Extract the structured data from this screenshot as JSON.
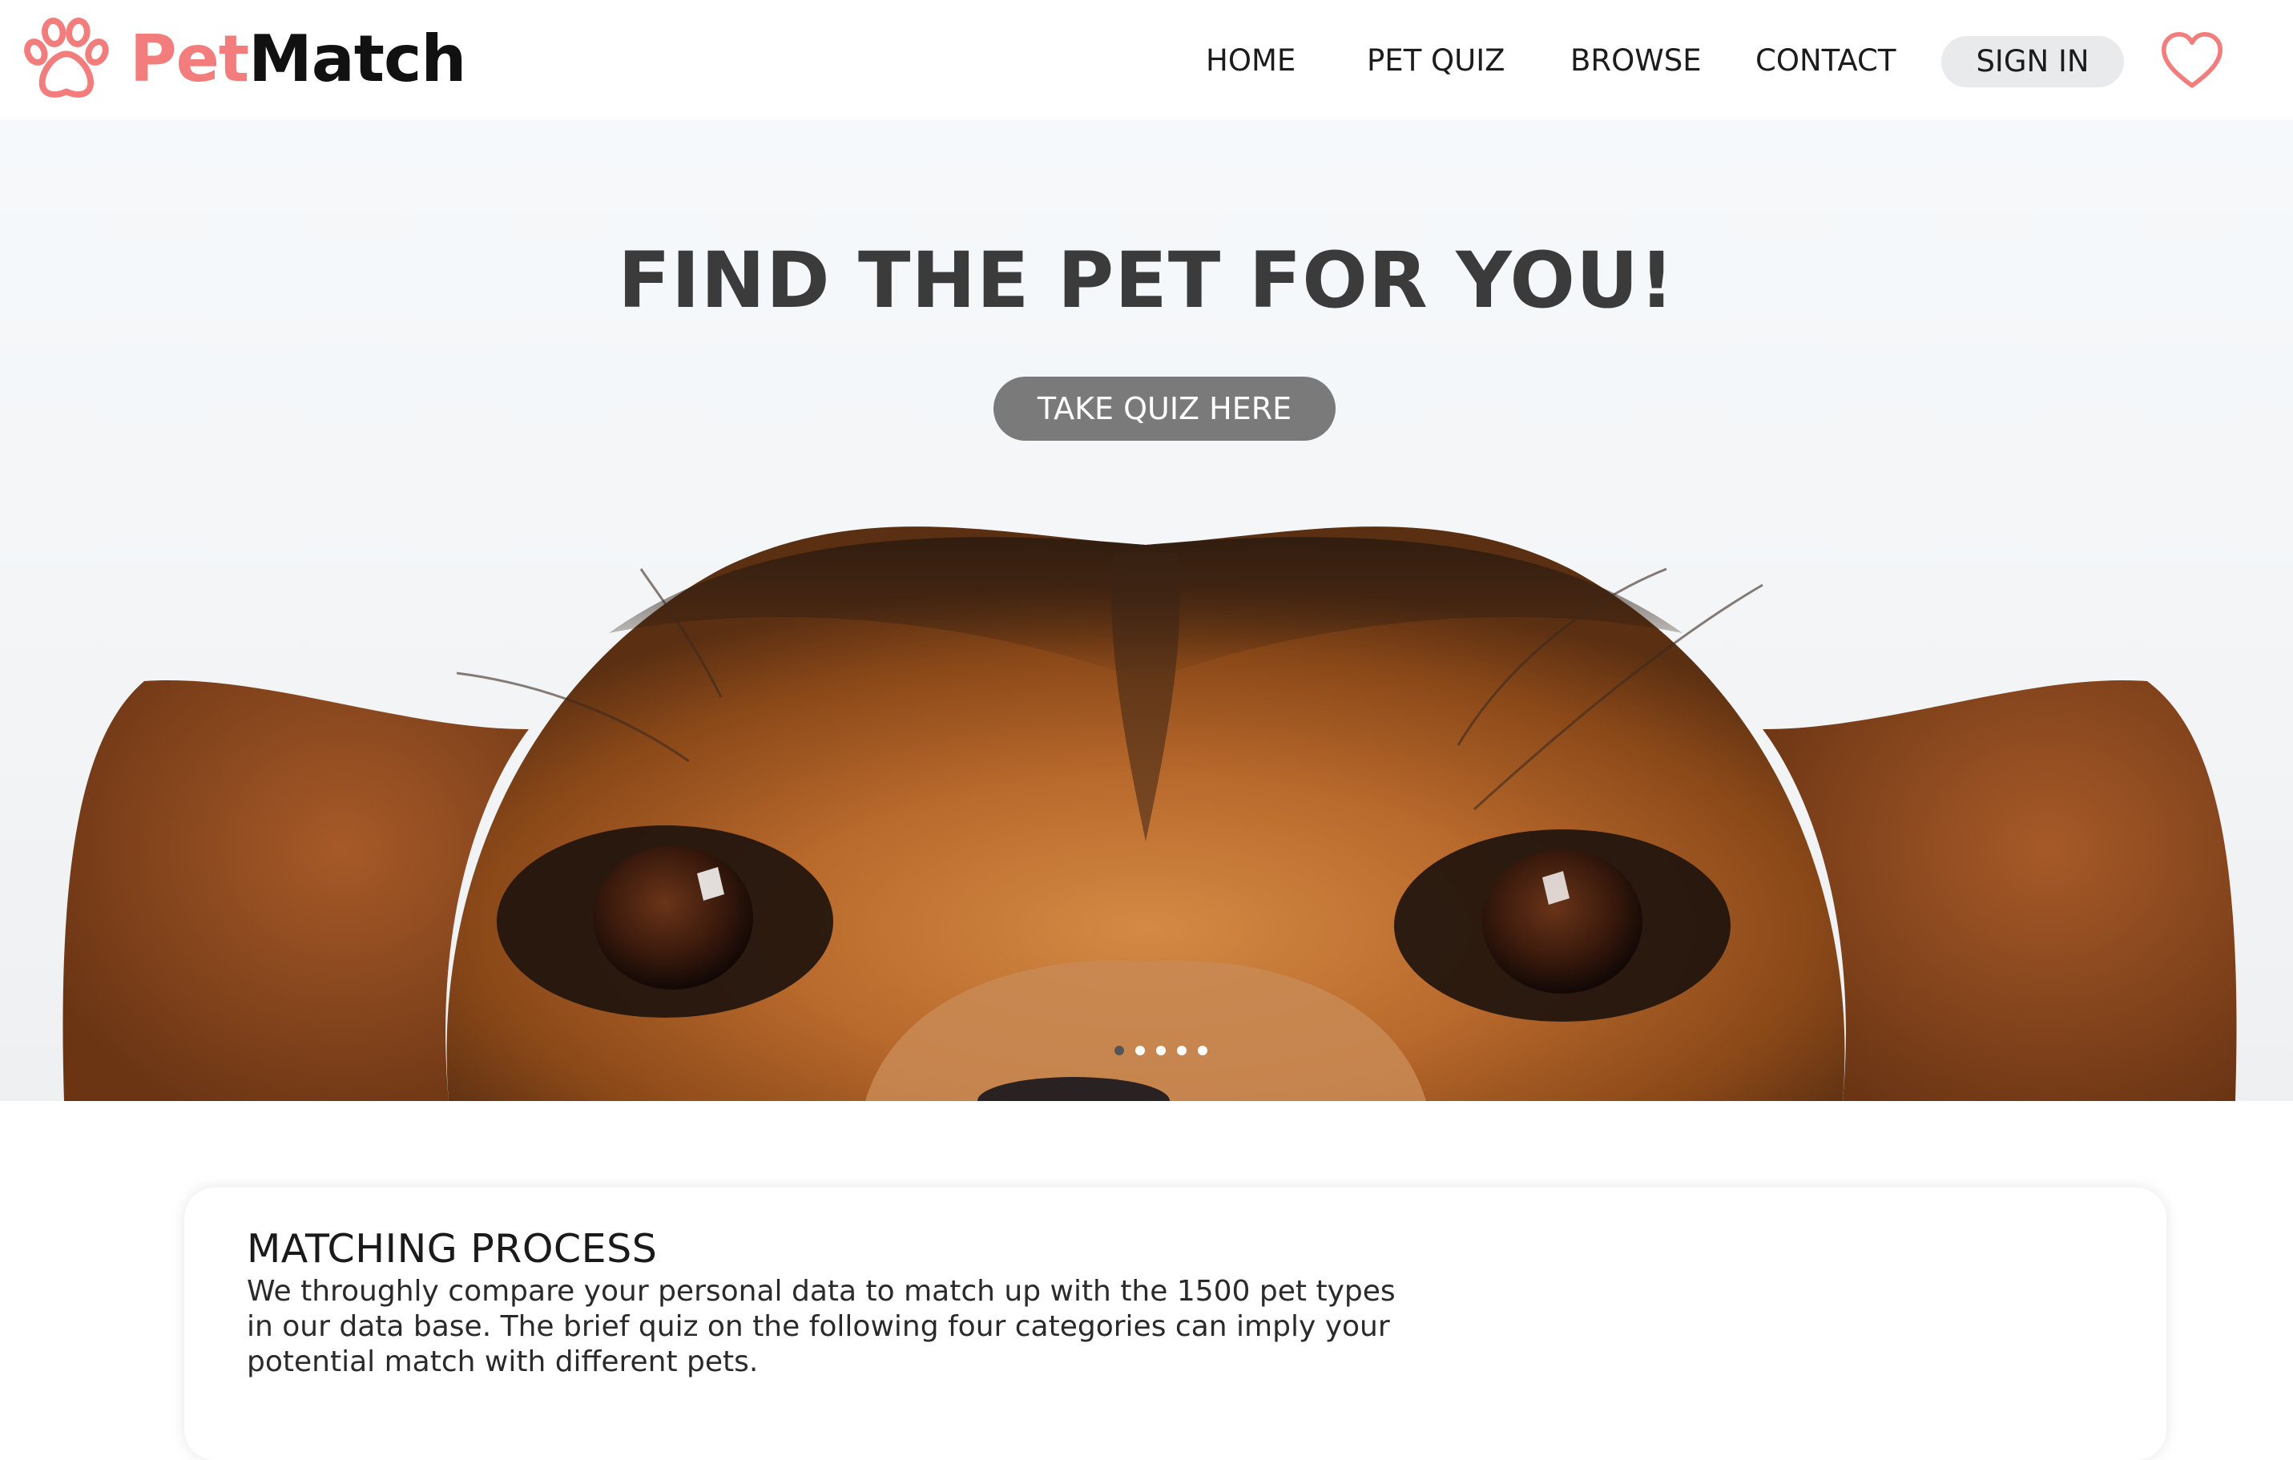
{
  "brand": {
    "name_part1": "Pet",
    "name_part2": "Match",
    "accent_color": "#f37c7c",
    "icon": "paw-icon"
  },
  "nav": {
    "items": [
      {
        "label": "HOME"
      },
      {
        "label": "PET QUIZ"
      },
      {
        "label": "BROWSE"
      },
      {
        "label": "CONTACT"
      }
    ],
    "signin_label": "SIGN IN",
    "favorites_icon": "heart-icon"
  },
  "hero": {
    "title": "FIND THE PET FOR YOU!",
    "cta_label": "TAKE QUIZ HERE",
    "carousel": {
      "count": 5,
      "active_index": 0
    }
  },
  "card": {
    "title": "MATCHING PROCESS",
    "lines": [
      "We throughly compare your personal data to match up with the 1500 pet types",
      "in our data base. The brief quiz on the following four categories can imply your",
      "potential match with different pets."
    ]
  }
}
